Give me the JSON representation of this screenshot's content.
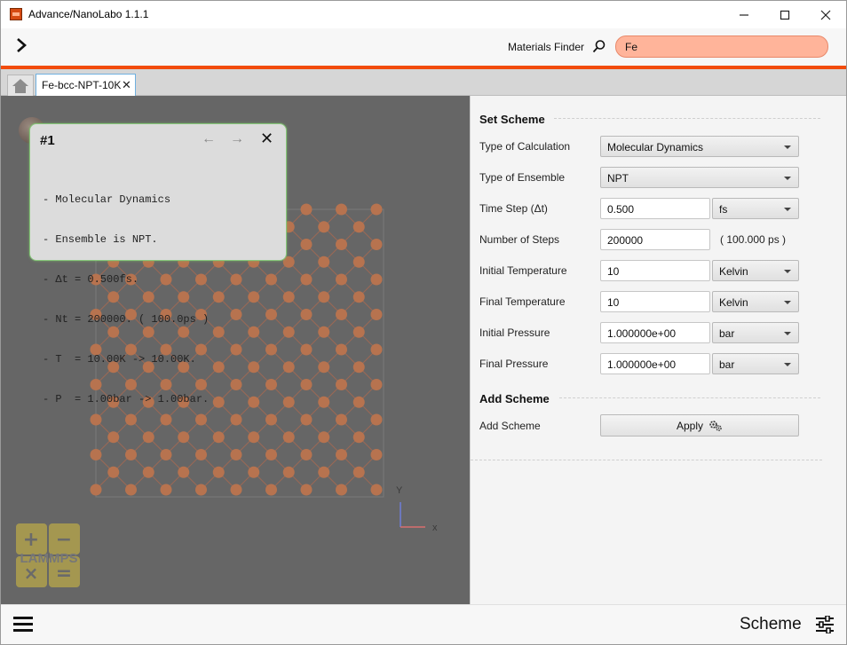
{
  "window": {
    "title": "Advance/NanoLabo 1.1.1",
    "controls": {
      "minimize": "—",
      "maximize": "☐",
      "close": "✕"
    }
  },
  "toolbar": {
    "expand_icon": "chevron-right-icon",
    "materials_finder_label": "Materials Finder",
    "search_icon": "search-icon",
    "search_value": "Fe"
  },
  "colors": {
    "accent": "#f24c0c",
    "search_bg": "#ffb49a",
    "viewport_bg": "#666666",
    "atom": "#b7734f",
    "bond": "#c86a46"
  },
  "tabs": [
    {
      "label": "Fe-bcc-NPT-10K",
      "close": "✕"
    }
  ],
  "viewport": {
    "element_symbol": "F  e",
    "axis_y": "Y",
    "axis_x": "x",
    "info_card": {
      "number": "#1",
      "prev": "←",
      "next": "→",
      "close": "✕",
      "lines": [
        "- Molecular Dynamics",
        "- Ensemble is NPT.",
        "- Δt = 0.500fs.",
        "- Nt = 200000. ( 100.0ps )",
        "- T  = 10.00K -> 10.00K.",
        "- P  = 1.00bar -> 1.00bar."
      ]
    },
    "logo": {
      "text": "LAMMPS",
      "ops": [
        "+",
        "−",
        "×",
        "="
      ]
    }
  },
  "panel": {
    "set_scheme_title": "Set Scheme",
    "rows": {
      "calc_type": {
        "label": "Type of Calculation",
        "value": "Molecular Dynamics"
      },
      "ensemble": {
        "label": "Type of Ensemble",
        "value": "NPT"
      },
      "time_step": {
        "label": "Time Step (Δt)",
        "value": "0.500",
        "unit": "fs"
      },
      "steps": {
        "label": "Number of Steps",
        "value": "200000",
        "note": "( 100.000 ps )"
      },
      "init_temp": {
        "label": "Initial Temperature",
        "value": "10",
        "unit": "Kelvin"
      },
      "final_temp": {
        "label": "Final Temperature",
        "value": "10",
        "unit": "Kelvin"
      },
      "init_press": {
        "label": "Initial Pressure",
        "value": "1.000000e+00",
        "unit": "bar"
      },
      "final_press": {
        "label": "Final Pressure",
        "value": "1.000000e+00",
        "unit": "bar"
      }
    },
    "add_scheme_title": "Add Scheme",
    "add_scheme_label": "Add Scheme",
    "apply_label": "Apply",
    "apply_icon": "gears-icon"
  },
  "bottombar": {
    "menu_icon": "hamburger-menu-icon",
    "scheme_label": "Scheme",
    "settings_icon": "sliders-icon"
  }
}
